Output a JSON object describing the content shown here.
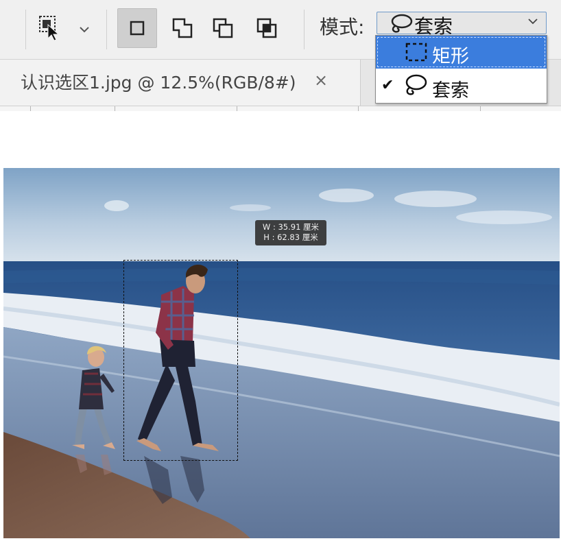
{
  "options_bar": {
    "mode_label": "模式:",
    "mode_value": "套索",
    "mode_options": [
      "矩形",
      "套索"
    ],
    "selected_highlight": "矩形",
    "checked_option": "套索",
    "check_mark": "✔"
  },
  "document_tab": {
    "title": "认识选区1.jpg @ 12.5%(RGB/8#)",
    "close_symbol": "×"
  },
  "selection_info": {
    "width_line": "W : 35.91 厘米",
    "height_line": "H : 62.83 厘米"
  },
  "colors": {
    "highlight": "#3b7ddd",
    "options_bg": "#f0f0f0",
    "tooltip_bg": "#333333"
  },
  "icons": [
    "selection-tool-icon",
    "chevron-down-icon",
    "new-selection-icon",
    "add-to-selection-icon",
    "subtract-from-selection-icon",
    "intersect-selection-icon",
    "lasso-icon",
    "rect-marquee-icon",
    "checkmark-icon",
    "close-icon"
  ]
}
